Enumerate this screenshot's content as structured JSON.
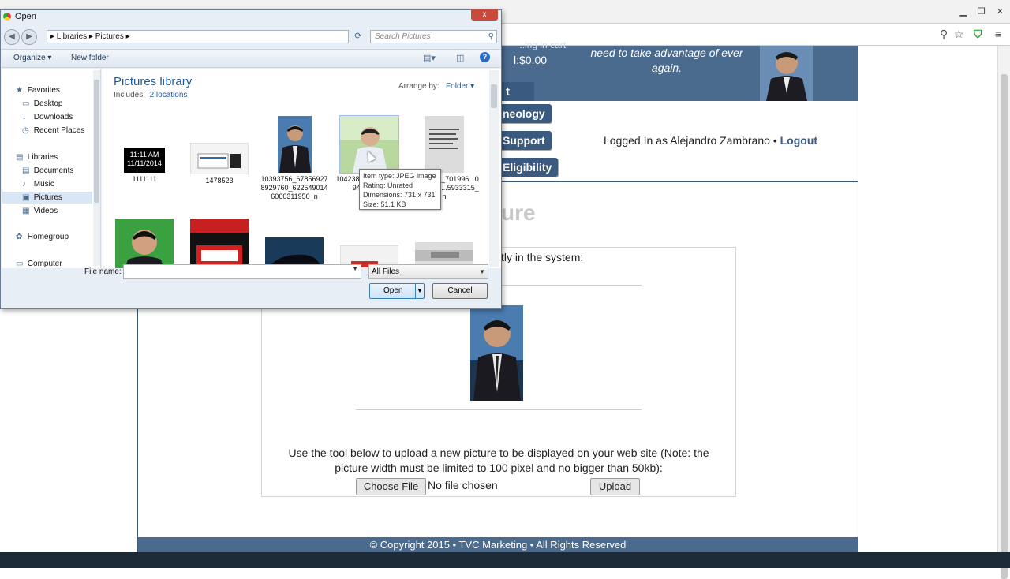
{
  "dialog": {
    "title": "Open",
    "close_label": "x",
    "breadcrumb": "▸ Libraries ▸ Pictures ▸",
    "search_placeholder": "Search Pictures",
    "organize_label": "Organize ▾",
    "new_folder_label": "New folder",
    "nav_items": [
      {
        "label": "Favorites",
        "icon": "★"
      },
      {
        "label": "Desktop",
        "icon": "▭"
      },
      {
        "label": "Downloads",
        "icon": "↓"
      },
      {
        "label": "Recent Places",
        "icon": "◷"
      },
      {
        "label": "Libraries",
        "icon": "▤"
      },
      {
        "label": "Documents",
        "icon": "▤"
      },
      {
        "label": "Music",
        "icon": "♪"
      },
      {
        "label": "Pictures",
        "icon": "▣"
      },
      {
        "label": "Videos",
        "icon": "▦"
      },
      {
        "label": "Homegroup",
        "icon": "✿"
      },
      {
        "label": "Computer",
        "icon": "▭"
      }
    ],
    "library_title": "Pictures library",
    "includes_label": "Includes:",
    "includes_link": "2 locations",
    "arrange_label": "Arrange by:",
    "arrange_value": "Folder ▾",
    "files": [
      {
        "name": "1111111",
        "thumb_text": "11:11 AM\n11/11/2014"
      },
      {
        "name": "1478523"
      },
      {
        "name": "10393756_678569278929760_6225490146060311950_n"
      },
      {
        "name": "10423879_672560779427808..."
      },
      {
        "name": "10537834_701996...018_45744...5933315_n"
      }
    ],
    "tooltip": {
      "type": "Item type: JPEG image",
      "rating": "Rating: Unrated",
      "dimensions": "Dimensions: 731 x 731",
      "size": "Size: 51.1 KB"
    },
    "filename_label": "File name:",
    "filename_value": "",
    "filter_value": "All Files",
    "open_label": "Open",
    "cancel_label": "Cancel"
  },
  "site": {
    "cart_hint": "...ing in cart",
    "cart_total": "l:$0.00",
    "tagline": "need to take advantage of ever again.",
    "nav_tab": "t",
    "nav_buttons": [
      "neology",
      "Support",
      "Eligibility"
    ],
    "logged_in_text": "Logged In as Alejandro Zambrano • ",
    "logout_label": "Logout",
    "page_title": "ure",
    "current_label": "tly in the system:",
    "upload_note": "Use the tool below to upload a new picture to be displayed on your web site (Note: the picture width must be limited to 100 pixel and no bigger than 50kb):",
    "choose_file_label": "Choose File",
    "no_file_text": "No file chosen",
    "upload_label": "Upload",
    "footer": "© Copyright 2015 • TVC Marketing • All Rights Reserved"
  }
}
